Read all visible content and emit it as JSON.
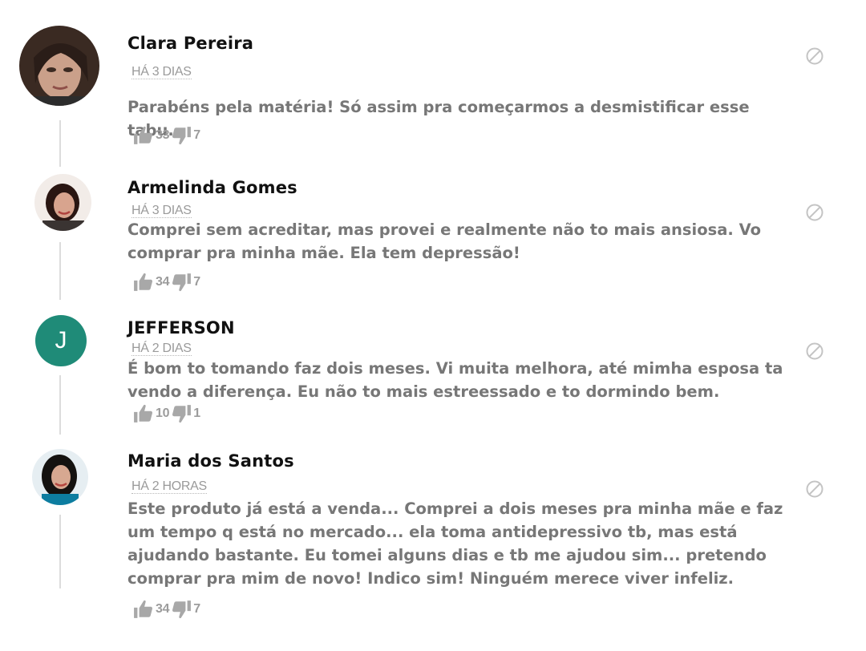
{
  "colors": {
    "author": "#111111",
    "text": "#777777",
    "meta": "#9a9a9a",
    "thread_line": "#dcdcdc",
    "avatar_initial_bg": "#1f8b78"
  },
  "icons": {
    "like": "thumbs-up-icon",
    "dislike": "thumbs-down-icon",
    "report": "report-block-icon"
  },
  "comments": [
    {
      "author": "Clara Pereira",
      "time": "HÁ 3 DIAS",
      "text": "Parabéns pela matéria! Só assim pra começarmos a desmistificar esse tabu.",
      "likes": "33",
      "dislikes": "7",
      "avatar": "photo"
    },
    {
      "author": "Armelinda Gomes",
      "time": "HÁ 3 DIAS",
      "text": "Comprei sem acreditar, mas provei e realmente não to mais ansiosa. Vo comprar pra minha mãe. Ela tem depressão!",
      "likes": "34",
      "dislikes": "7",
      "avatar": "photo"
    },
    {
      "author": "JEFFERSON",
      "time": "HÁ 2 DIAS",
      "text": "É bom to tomando faz dois meses. Vi muita melhora, até mimha esposa ta vendo a diferença. Eu não to mais estreessado e to dormindo bem.",
      "likes": "10",
      "dislikes": "1",
      "avatar": "initial",
      "initial": "J"
    },
    {
      "author": "Maria dos Santos",
      "time": "HÁ 2 HORAS",
      "text": "Este produto já está a venda... Comprei a dois meses pra minha mãe e faz um tempo q está no mercado... ela toma antidepressivo tb, mas está ajudando bastante. Eu tomei alguns dias e tb me ajudou sim... pretendo comprar pra mim de novo! Indico sim! Ninguém merece viver infeliz.",
      "likes": "34",
      "dislikes": "7",
      "avatar": "photo"
    }
  ]
}
